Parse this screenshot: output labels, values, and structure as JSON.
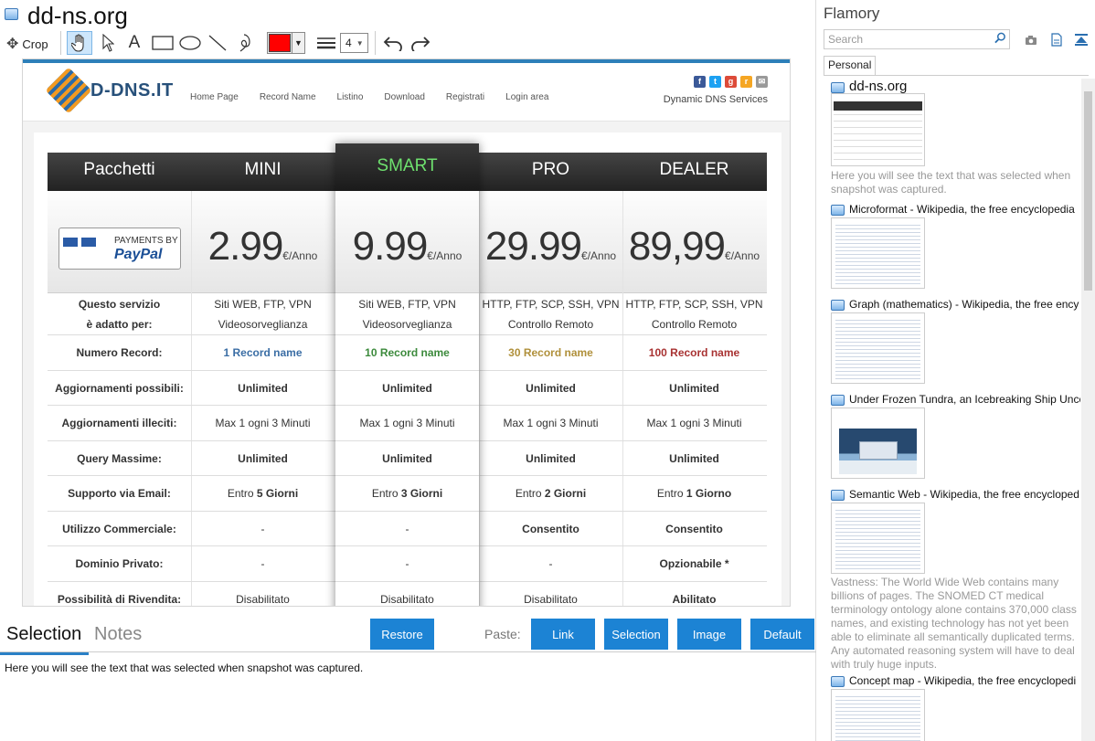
{
  "window_title": "dd-ns.org",
  "toolbar": {
    "crop_label": "Crop",
    "line_width": "4",
    "colors": {
      "stroke": "#ff0000",
      "accent": "#1c83d4"
    },
    "tools": [
      "hand-icon",
      "pointer-icon",
      "text-icon",
      "rectangle-icon",
      "ellipse-icon",
      "line-icon",
      "freehand-icon",
      "undo-icon",
      "redo-icon"
    ]
  },
  "site": {
    "logo_text": "D-DNS.IT",
    "nav": [
      "Home Page",
      "Record Name",
      "Listino",
      "Download",
      "Registrati",
      "Login area"
    ],
    "tagline": "Dynamic DNS Services",
    "pricing": {
      "header_label": "Pacchetti",
      "paypal_top": "PAYMENTS BY",
      "paypal_brand": "PayPal",
      "plans": [
        {
          "name": "MINI",
          "price": "2.99",
          "unit": "€/Anno"
        },
        {
          "name": "SMART",
          "price": "9.99",
          "unit": "€/Anno"
        },
        {
          "name": "PRO",
          "price": "29.99",
          "unit": "€/Anno"
        },
        {
          "name": "DEALER",
          "price": "89,99",
          "unit": "€/Anno"
        }
      ],
      "rows": [
        {
          "label": "Questo servizio\nè adatto per:",
          "values": [
            "Siti WEB, FTP, VPN\nVideosorveglianza",
            "Siti WEB, FTP, VPN\nVideosorveglianza",
            "HTTP, FTP, SCP, SSH, VPN\nControllo Remoto",
            "HTTP, FTP, SCP, SSH, VPN\nControllo Remoto"
          ]
        },
        {
          "label": "Numero Record:",
          "values": [
            "1 Record name",
            "10 Record name",
            "30 Record name",
            "100 Record name"
          ],
          "colors": [
            "#3b6ea5",
            "#3c8a3c",
            "#b0903b",
            "#a83232"
          ]
        },
        {
          "label": "Aggiornamenti possibili:",
          "values": [
            "Unlimited",
            "Unlimited",
            "Unlimited",
            "Unlimited"
          ]
        },
        {
          "label": "Aggiornamenti illeciti:",
          "values": [
            "Max 1 ogni 3 Minuti",
            "Max 1 ogni 3 Minuti",
            "Max 1 ogni 3 Minuti",
            "Max 1 ogni 3 Minuti"
          ]
        },
        {
          "label": "Query Massime:",
          "values": [
            "Unlimited",
            "Unlimited",
            "Unlimited",
            "Unlimited"
          ]
        },
        {
          "label": "Supporto via Email:",
          "values": [
            "Entro 5 Giorni",
            "Entro 3 Giorni",
            "Entro 2 Giorni",
            "Entro 1 Giorno"
          ]
        },
        {
          "label": "Utilizzo Commerciale:",
          "values": [
            "-",
            "-",
            "Consentito",
            "Consentito"
          ]
        },
        {
          "label": "Dominio Privato:",
          "values": [
            "-",
            "-",
            "-",
            "Opzionabile *"
          ]
        },
        {
          "label": "Possibilità di Rivendita:",
          "values": [
            "Disabilitato",
            "Disabilitato",
            "Disabilitato",
            "Abilitato"
          ]
        }
      ]
    }
  },
  "bottom": {
    "tab_selection": "Selection",
    "tab_notes": "Notes",
    "restore_label": "Restore",
    "paste_label": "Paste:",
    "paste_buttons": [
      "Link",
      "Selection",
      "Image",
      "Default"
    ],
    "selection_text": "Here you will see the text that was selected when snapshot was captured."
  },
  "sidebar": {
    "title": "Flamory",
    "search_placeholder": "Search",
    "tab": "Personal",
    "items": [
      {
        "title": "dd-ns.org",
        "desc": "Here you will see the text that was selected when snapshot was captured."
      },
      {
        "title": "Microformat - Wikipedia, the free encyclopedia",
        "desc": ""
      },
      {
        "title": "Graph (mathematics) - Wikipedia, the free ency",
        "desc": ""
      },
      {
        "title": "Under Frozen Tundra, an Icebreaking Ship Unco",
        "desc": ""
      },
      {
        "title": "Semantic Web - Wikipedia, the free encycloped",
        "desc": "Vastness: The World Wide Web contains many billions of pages. The SNOMED CT medical terminology ontology alone contains 370,000 class names, and existing technology has not yet been able to eliminate all semantically duplicated terms. Any automated reasoning system will have to deal with truly huge inputs."
      },
      {
        "title": "Concept map - Wikipedia, the free encyclopedi",
        "desc": ""
      }
    ]
  }
}
